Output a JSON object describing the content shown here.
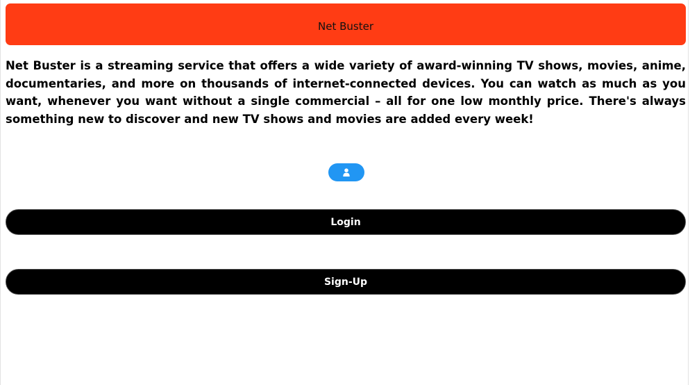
{
  "header": {
    "title": "Net Buster",
    "color": "#ff3c14"
  },
  "description": "Net Buster is a streaming service that offers a wide variety of award-winning TV shows, movies, anime, documentaries, and more on thousands of internet-connected devices. You can watch as much as you want, whenever you want without a single commercial – all for one low monthly price. There's always something new to discover and new TV shows and movies are added every week!",
  "account_button": {
    "icon": "user-icon",
    "color": "#2196f3"
  },
  "actions": {
    "login_label": "Login",
    "signup_label": "Sign-Up"
  }
}
